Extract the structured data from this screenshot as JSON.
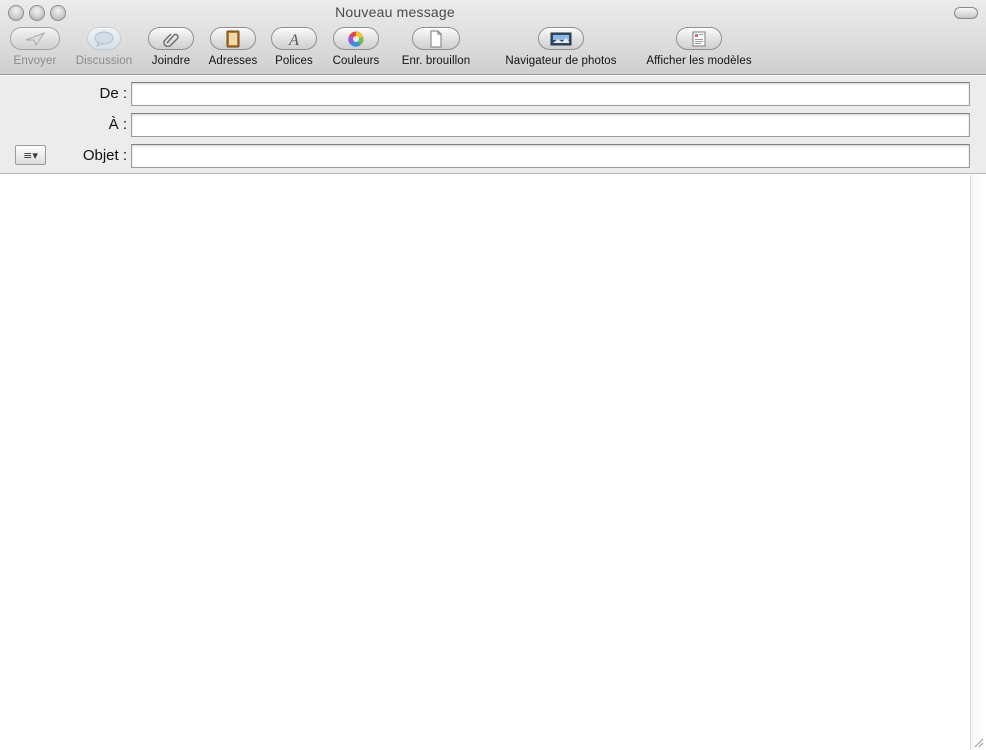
{
  "window": {
    "title": "Nouveau message"
  },
  "toolbar": {
    "items": [
      {
        "label": "Envoyer",
        "icon": "paper-plane-icon",
        "enabled": false
      },
      {
        "label": "Discussion",
        "icon": "speech-bubble-icon",
        "enabled": false
      },
      {
        "label": "Joindre",
        "icon": "paperclip-icon",
        "enabled": true
      },
      {
        "label": "Adresses",
        "icon": "address-book-icon",
        "enabled": true
      },
      {
        "label": "Polices",
        "icon": "font-icon",
        "enabled": true
      },
      {
        "label": "Couleurs",
        "icon": "color-wheel-icon",
        "enabled": true
      },
      {
        "label": "Enr. brouillon",
        "icon": "draft-document-icon",
        "enabled": true
      },
      {
        "label": "Navigateur de photos",
        "icon": "photo-icon",
        "enabled": true
      },
      {
        "label": "Afficher les modèles",
        "icon": "templates-icon",
        "enabled": true
      }
    ]
  },
  "header": {
    "from_label": "De :",
    "to_label": "À :",
    "subject_label": "Objet :",
    "from_value": "",
    "to_value": "",
    "subject_value": "",
    "menu_button_glyph": "≡▾"
  },
  "body": {
    "content": ""
  }
}
